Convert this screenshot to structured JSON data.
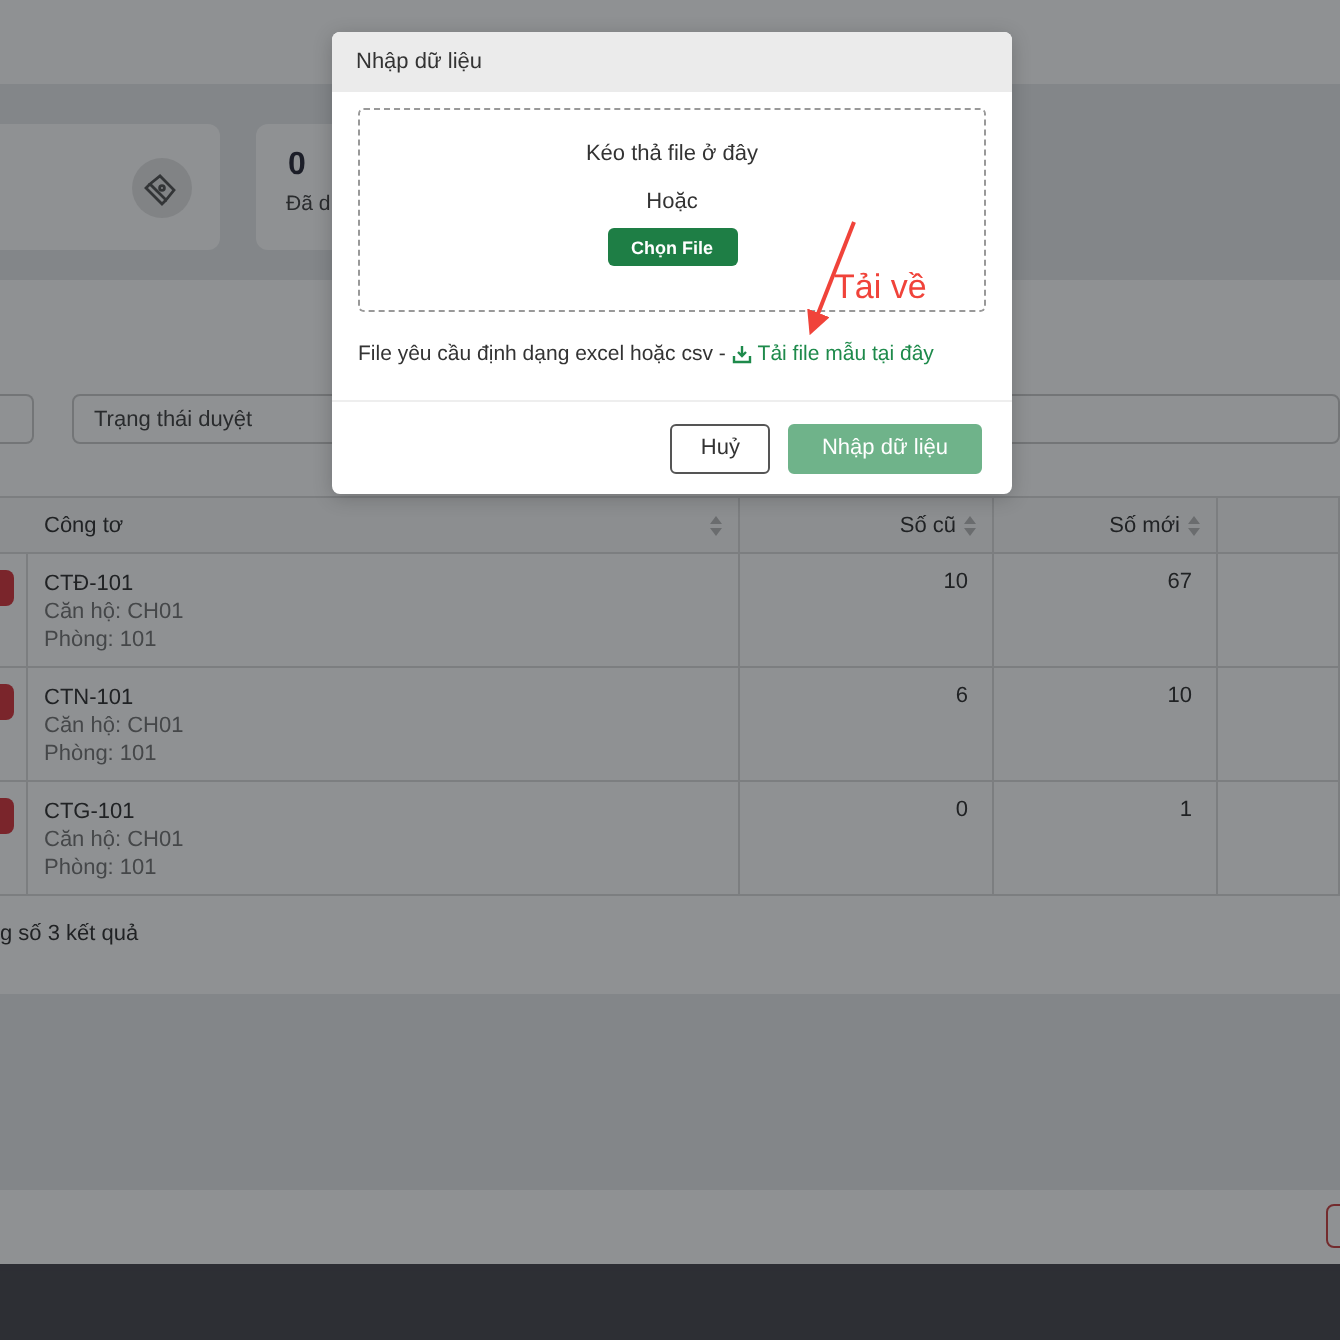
{
  "stat_cards": [
    {
      "kind": "icon"
    },
    {
      "kind": "value",
      "value": "0",
      "label": "Đã d"
    }
  ],
  "filters": [
    {
      "kind": "input"
    },
    {
      "kind": "select",
      "placeholder": "Trạng thái duyệt"
    }
  ],
  "table": {
    "columns": [
      {
        "label": "Công tơ"
      },
      {
        "label": "Số cũ"
      },
      {
        "label": "Số mới"
      }
    ],
    "rows": [
      {
        "meter": "CTĐ-101",
        "apartment": "Căn hộ: CH01",
        "room": "Phòng: 101",
        "old": "10",
        "new": "67"
      },
      {
        "meter": "CTN-101",
        "apartment": "Căn hộ: CH01",
        "room": "Phòng: 101",
        "old": "6",
        "new": "10"
      },
      {
        "meter": "CTG-101",
        "apartment": "Căn hộ: CH01",
        "room": "Phòng: 101",
        "old": "0",
        "new": "1"
      }
    ]
  },
  "result_count": "g số 3 kết quả",
  "modal": {
    "title": "Nhập dữ liệu",
    "drop_hint": "Kéo thả file ở đây",
    "or": "Hoặc",
    "choose_button": "Chọn File",
    "note": "File yêu cầu định dạng excel hoặc csv - ",
    "template_link": "Tải file mẫu tại đây",
    "buttons": [
      {
        "label": "Huỷ",
        "kind": "secondary",
        "disabled": false
      },
      {
        "label": "Nhập dữ liệu",
        "kind": "primary",
        "disabled": true
      }
    ]
  },
  "annotation": {
    "text": "Tải về"
  }
}
